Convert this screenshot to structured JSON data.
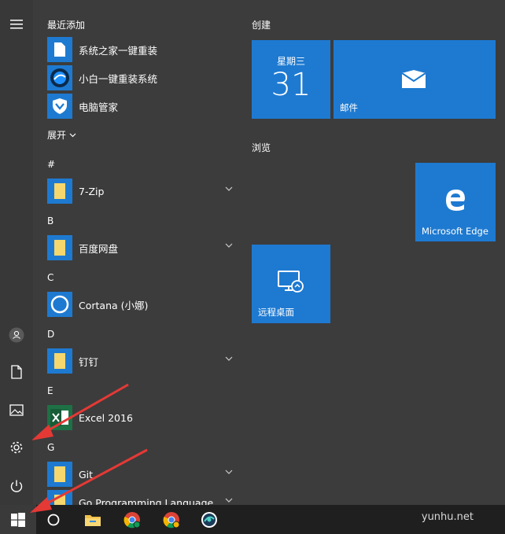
{
  "applist": {
    "recent_header": "最近添加",
    "recent_items": [
      {
        "label": "系统之家一键重装",
        "icon": "document-icon"
      },
      {
        "label": "小白一键重装系统",
        "icon": "xiaobai-logo-icon"
      },
      {
        "label": "电脑管家",
        "icon": "shield-icon"
      }
    ],
    "expand_label": "展开",
    "sections": [
      {
        "letter": "#",
        "items": [
          {
            "label": "7-Zip",
            "icon": "folder-icon",
            "expandable": true
          }
        ]
      },
      {
        "letter": "B",
        "items": [
          {
            "label": "百度网盘",
            "icon": "folder-icon",
            "expandable": true
          }
        ]
      },
      {
        "letter": "C",
        "items": [
          {
            "label": "Cortana (小娜)",
            "icon": "cortana-icon",
            "expandable": false
          }
        ]
      },
      {
        "letter": "D",
        "items": [
          {
            "label": "钉钉",
            "icon": "folder-icon",
            "expandable": true
          }
        ]
      },
      {
        "letter": "E",
        "items": [
          {
            "label": "Excel 2016",
            "icon": "excel-icon",
            "expandable": false
          }
        ]
      },
      {
        "letter": "G",
        "items": [
          {
            "label": "Git",
            "icon": "folder-icon",
            "expandable": true
          },
          {
            "label": "Go Programming Language",
            "icon": "folder-icon",
            "expandable": true
          }
        ]
      }
    ]
  },
  "tiles": {
    "group_create": "创建",
    "calendar_day": "星期三",
    "calendar_date": "31",
    "mail_label": "邮件",
    "group_browse": "浏览",
    "edge_label": "Microsoft Edge",
    "remote_label": "远程桌面"
  },
  "rail": {
    "icons": [
      "hamburger-menu-icon",
      "user-icon",
      "documents-icon",
      "pictures-icon",
      "settings-gear-icon",
      "power-icon"
    ]
  },
  "taskbar": {
    "watermark": "yunhu.net",
    "icons": [
      "windows-start-icon",
      "cortana-search-icon",
      "file-explorer-icon",
      "chrome-icon",
      "chrome-alt-icon",
      "app-icon"
    ]
  },
  "colors": {
    "tile_blue": "#1e7ad1",
    "menu_bg": "#3c3c3c",
    "taskbar_bg": "#1f1f1f",
    "arrow_red": "#e53935",
    "folder_yellow": "#f5d76e"
  }
}
